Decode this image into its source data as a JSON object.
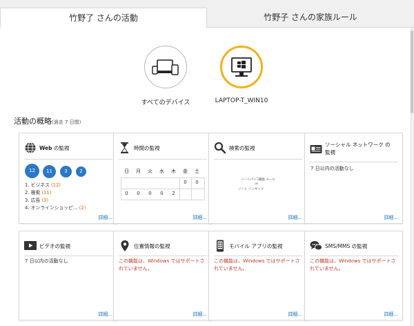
{
  "tabs": [
    {
      "label": "竹野了 さんの活動",
      "active": true
    },
    {
      "label": "竹野子 さんの家族ルール",
      "active": false
    }
  ],
  "devices": [
    {
      "label": "すべてのデバイス",
      "icon": "all-devices-icon",
      "selected": false
    },
    {
      "label": "LAPTOP-T_WIN10",
      "icon": "monitor-icon",
      "selected": true
    }
  ],
  "overview": {
    "title": "活動の概略",
    "subtitle": "(過去 7 日間)"
  },
  "colors": {
    "accent": "#2b78c6",
    "selected_ring": "#f0b21a",
    "link": "#1a6fb5",
    "warning": "#c0392b",
    "count": "#d0690c"
  },
  "cards": {
    "web": {
      "title_strong": "Web",
      "title_rest": " の監視",
      "icon": "globe-icon",
      "badges": [
        "12",
        "11",
        "3",
        "2"
      ],
      "categories": [
        {
          "name": "1. ビジネス ",
          "count": "(12)"
        },
        {
          "name": "2. 検索 ",
          "count": "(11)"
        },
        {
          "name": "3. 広告 ",
          "count": "(3)"
        },
        {
          "name": "4. オンラインショッピ… ",
          "count": "(2)"
        }
      ],
      "more": "詳細..."
    },
    "time": {
      "title": "時間の監視",
      "icon": "hourglass-icon",
      "days": [
        "日",
        "月",
        "火",
        "水",
        "木",
        "金",
        "土"
      ],
      "row_top": [
        "",
        "",
        "",
        "",
        "",
        "0",
        "0"
      ],
      "row_bottom": [
        "0",
        "0",
        "0",
        "0",
        "2",
        "",
        ""
      ],
      "more": "詳細..."
    },
    "search": {
      "title": "検索の監視",
      "icon": "search-icon",
      "terms": [
        "ノートパソコン",
        "液晶 メール",
        "us",
        "ノート インサイド"
      ],
      "more": "詳細..."
    },
    "social": {
      "title": "ソーシャル ネットワーク の監視",
      "icon": "social-network-icon",
      "status": "7 日以内の活動なし",
      "more": "詳細..."
    },
    "video": {
      "title": "ビデオの監視",
      "icon": "video-icon",
      "status": "7 日以内の活動なし",
      "more": "詳細..."
    },
    "location": {
      "title": "位置情報の監視",
      "icon": "location-pin-icon",
      "status": "この機能は、Windows ではサポートされていません。",
      "more": "詳細..."
    },
    "mobile": {
      "title": "モバイル アプリの監視",
      "icon": "mobile-phone-icon",
      "status": "この機能は、Windows ではサポートされていません。",
      "more": "詳細..."
    },
    "sms": {
      "title": "SMS/MMS の監視",
      "icon": "chat-bubbles-icon",
      "status": "この機能は、Windows ではサポートされていません。",
      "more": "詳細..."
    }
  }
}
